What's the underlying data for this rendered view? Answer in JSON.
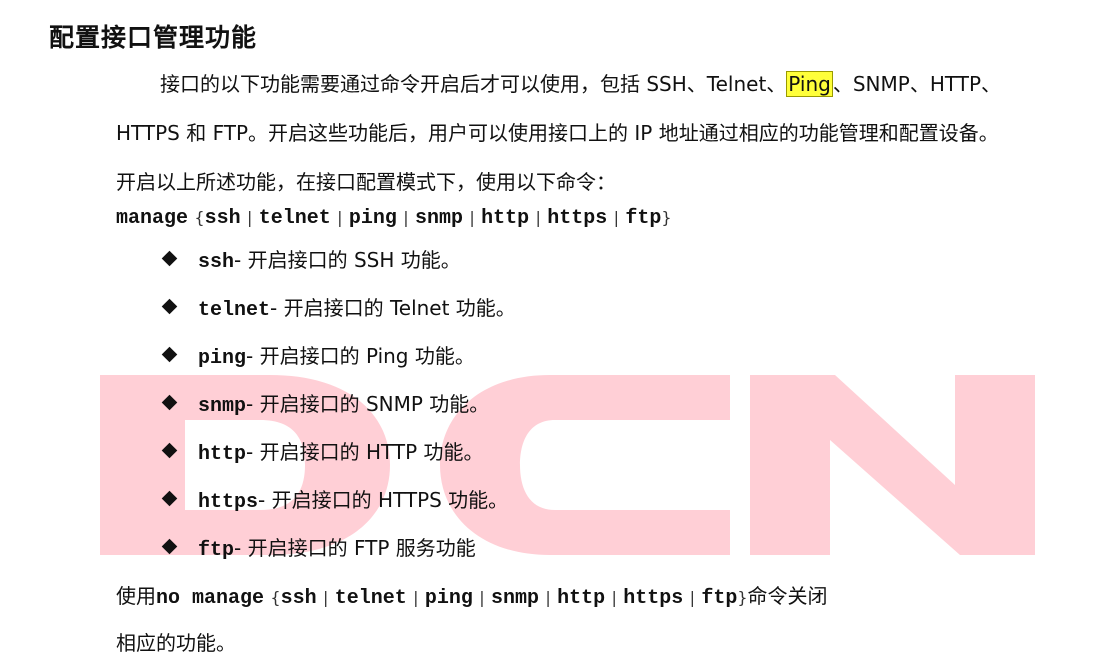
{
  "watermark": {
    "text": "DCN",
    "color": "#ffcfd6"
  },
  "title": "配置接口管理功能",
  "para1": {
    "line1_before": "接口的以下功能需要通过命令开启后才可以使用，包括 SSH、Telnet、",
    "line1_highlight": "Ping",
    "line1_after": "、SNMP、HTTP、",
    "line2": "HTTPS 和 FTP。开启这些功能后，用户可以使用接口上的 IP 地址通过相应的功能管理和配置设备。"
  },
  "para2": "开启以上所述功能，在接口配置模式下，使用以下命令：",
  "syntax": {
    "cmd": "manage",
    "open": "{",
    "opts": [
      "ssh",
      "telnet",
      "ping",
      "snmp",
      "http",
      "https",
      "ftp"
    ],
    "sep": "|",
    "close": "}"
  },
  "bullets": [
    {
      "cmd": "ssh",
      "desc": " - 开启接口的 SSH 功能。"
    },
    {
      "cmd": "telnet",
      "desc": " - 开启接口的 Telnet 功能。"
    },
    {
      "cmd": "ping",
      "desc": " - 开启接口的 Ping 功能。"
    },
    {
      "cmd": "snmp",
      "desc": " - 开启接口的 SNMP 功能。"
    },
    {
      "cmd": "http",
      "desc": " - 开启接口的 HTTP 功能。"
    },
    {
      "cmd": "https",
      "desc": " - 开启接口的 HTTPS 功能。"
    },
    {
      "cmd": "ftp",
      "desc": " - 开启接口的 FTP 服务功能"
    }
  ],
  "closing": {
    "prefix": "使用",
    "cmd": "no manage",
    "suffix": "命令关闭",
    "line2": "相应的功能。"
  }
}
